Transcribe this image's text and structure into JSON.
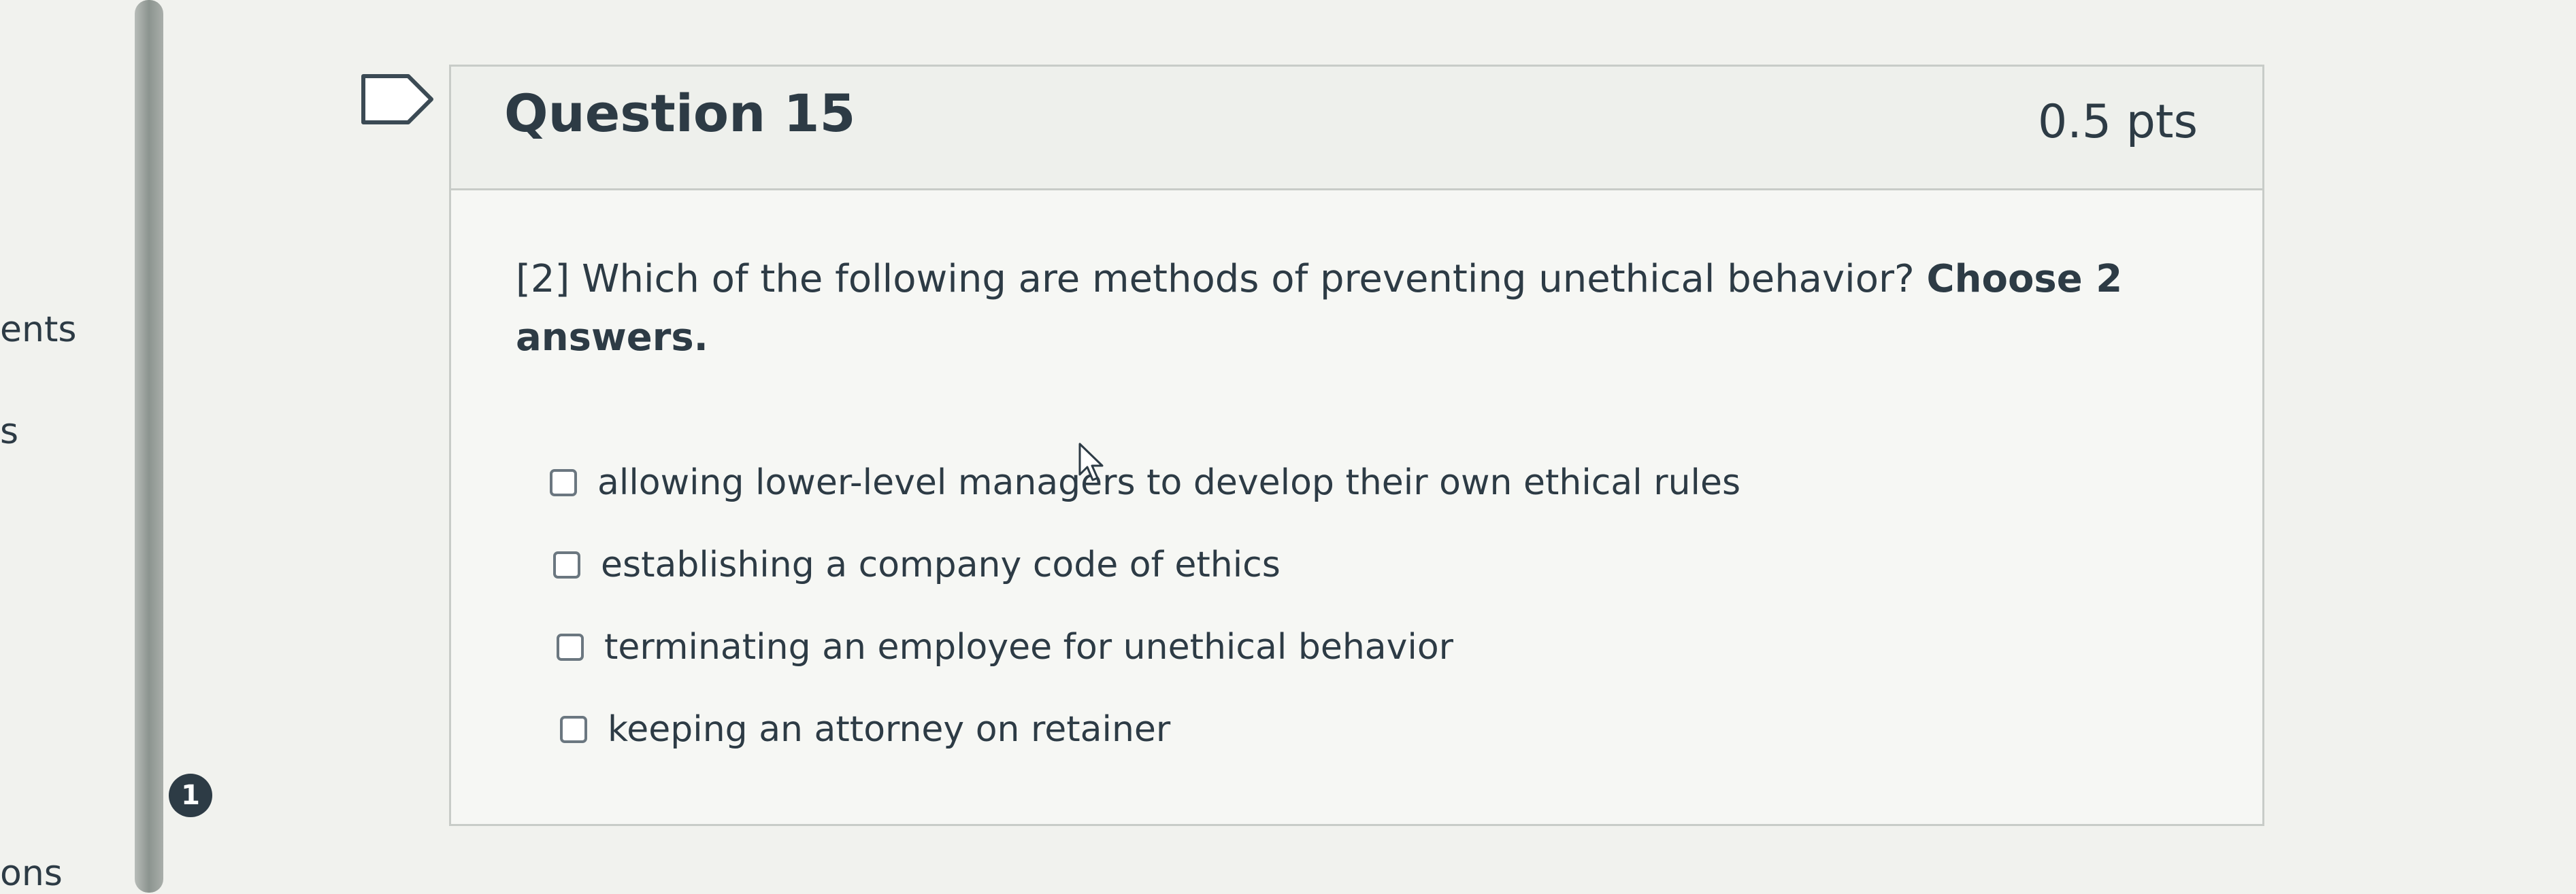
{
  "nav": {
    "item1": "ents",
    "item2": "s",
    "item3": "ons",
    "badge": "1"
  },
  "question": {
    "title": "Question 15",
    "points": "0.5 pts",
    "prompt": "[2] Which of the following are methods of preventing unethical behavior?",
    "emphasis": "Choose 2 answers.",
    "answers": [
      {
        "label": "allowing lower-level managers to develop their own ethical rules",
        "checked": false
      },
      {
        "label": "establishing a company code of ethics",
        "checked": false
      },
      {
        "label": "terminating an employee for unethical behavior",
        "checked": false
      },
      {
        "label": "keeping an attorney on retainer",
        "checked": false
      }
    ]
  },
  "icons": {
    "flag": "flag-bookmark-icon",
    "cursor": "mouse-pointer-icon"
  }
}
